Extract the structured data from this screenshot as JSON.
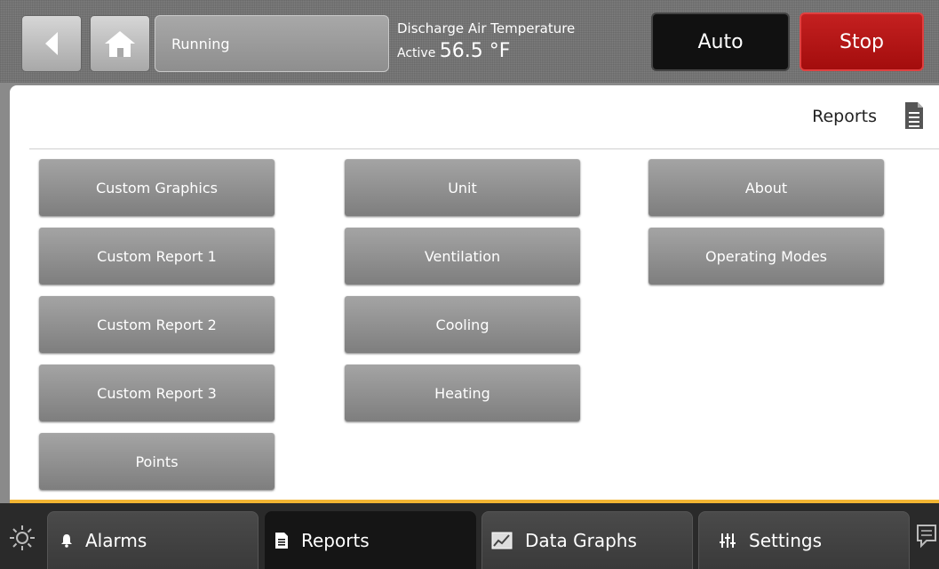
{
  "header": {
    "status_text": "Running",
    "temperature_label": "Discharge Air Temperature",
    "temperature_state": "Active",
    "temperature_value": "56.5 °F",
    "auto_label": "Auto",
    "stop_label": "Stop"
  },
  "panel": {
    "title": "Reports",
    "columns": [
      [
        "Custom Graphics",
        "Custom Report 1",
        "Custom Report 2",
        "Custom Report 3",
        "Points"
      ],
      [
        "Unit",
        "Ventilation",
        "Cooling",
        "Heating"
      ],
      [
        "About",
        "Operating Modes"
      ]
    ]
  },
  "tabs": [
    {
      "label": "Alarms",
      "icon": "bell-icon",
      "active": false
    },
    {
      "label": "Reports",
      "icon": "document-icon",
      "active": true
    },
    {
      "label": "Data Graphs",
      "icon": "chart-icon",
      "active": false
    },
    {
      "label": "Settings",
      "icon": "sliders-icon",
      "active": false
    }
  ],
  "colors": {
    "stop": "#b81515",
    "accent_line": "#f2b533"
  }
}
